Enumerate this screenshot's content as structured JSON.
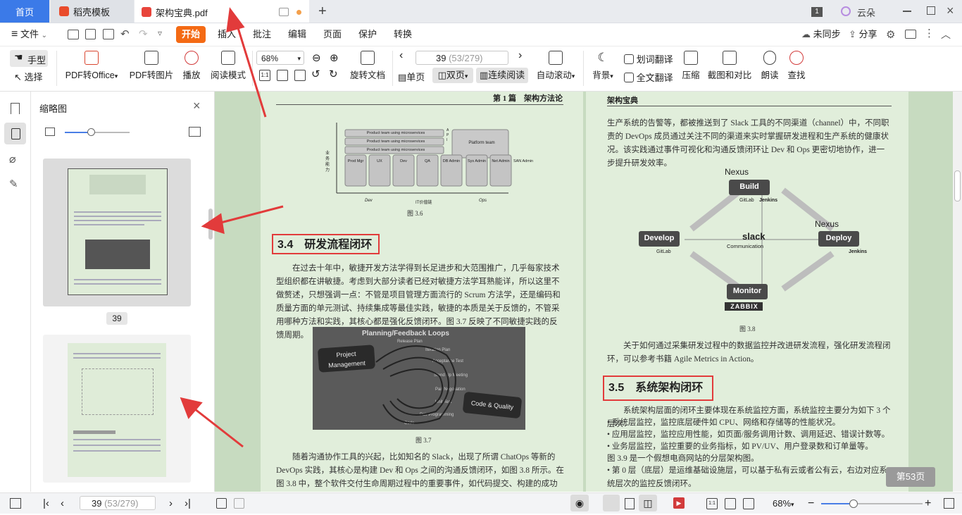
{
  "tabs": {
    "home": "首页",
    "daoke": "稻壳模板",
    "pdf": "架构宝典.pdf",
    "add": "+",
    "page_count_badge": "1",
    "cloud": "云朵"
  },
  "menu": {
    "file": "文件",
    "start": "开始",
    "insert": "插入",
    "annotate": "批注",
    "edit": "编辑",
    "page": "页面",
    "protect": "保护",
    "convert": "转换",
    "sync": "未同步",
    "share": "分享"
  },
  "toolbar": {
    "hand": "手型",
    "select": "选择",
    "pdf_office": "PDF转Office",
    "pdf_image": "PDF转图片",
    "play": "播放",
    "read_mode": "阅读模式",
    "zoom": "68%",
    "rotate": "旋转文档",
    "page_input": "39",
    "page_total": "(53/279)",
    "single": "单页",
    "double": "双页",
    "continuous": "连续阅读",
    "autoscroll": "自动滚动",
    "background": "背景",
    "word_translate": "划词翻译",
    "full_translate": "全文翻译",
    "compress": "压缩",
    "screenshot": "截图和对比",
    "read_aloud": "朗读",
    "search": "查找"
  },
  "thumbnail_panel": {
    "title": "缩略图",
    "page1_number": "39"
  },
  "doc": {
    "left_header": "第 1 篇　架构方法论",
    "right_header": "架构宝典",
    "fig36_caption": "图 3.6",
    "fig36_yaxis": "业务能力",
    "fig36_x": [
      "Dev",
      "IT价值链",
      "Ops"
    ],
    "fig36_rows": [
      "Product team using microservices",
      "Product team using microservices",
      "Product team using microservices"
    ],
    "fig36_platform": "Platform team",
    "fig36_roles": [
      "Prod Mgr",
      "UX",
      "Dev",
      "QA",
      "DB Admin",
      "Sys Admin",
      "Net Admin",
      "SAN Admin"
    ],
    "fig36_api": "A P I",
    "sec34": "3.4　研发流程闭环",
    "para34": "在过去十年中，敏捷开发方法学得到长足进步和大范围推广，几乎每家技术型组织都在讲敏捷。考虑到大部分读者已经对敏捷方法学耳熟能详，所以这里不做赘述，只想强调一点：不管是项目管理方面流行的 Scrum 方法学，还是编码和质量方面的单元测试、持续集成等最佳实践，敏捷的本质是关于反馈的，不管采用哪种方法和实践，其核心都是强化反馈闭环。图 3.7 反映了不同敏捷实践的反馈周期。",
    "fig37_title": "Planning/Feedback Loops",
    "fig37_pm": "Project Management",
    "fig37_cq": "Code & Quality",
    "fig37_items": [
      "Release Plan",
      "Iteration Plan",
      "Acceptance Test",
      "Stand Up Meeting",
      "Pair Negotiation",
      "Unit Test",
      "Pair Programming",
      "Code"
    ],
    "fig37_caption": "图 3.7",
    "para_bottom": "随着沟通协作工具的兴起，比如知名的 Slack，出现了所谓 ChatOps 等新的 DevOps 实践，其核心是构建 Dev 和 Ops 之间的沟通反馈闭环，如图 3.8 所示。在图 3.8 中，整个软件交付生命周期过程中的重要事件，如代码提交、构建的成功和失败、构建包的上传/部署、",
    "right_para1": "生产系统的告警等，都被推送到了 Slack 工具的不同渠道（channel）中，不同职责的 DevOps 成员通过关注不同的渠道来实时掌握研发进程和生产系统的健康状况。该实践通过事件可视化和沟通反馈闭环让 Dev 和 Ops 更密切地协作，进一步提升研发效率。",
    "fig38_nodes": [
      "Build",
      "Deploy",
      "Develop",
      "Monitor"
    ],
    "fig38_nexus": "Nexus",
    "fig38_jenkins": "Jenkins",
    "fig38_gitlab": "GitLab",
    "fig38_slack": "slack",
    "fig38_comm": "Communication",
    "fig38_zabbix": "ZABBIX",
    "fig38_caption": "图 3.8",
    "right_para2": "关于如何通过采集研发过程中的数据监控并改进研发流程，强化研发流程闭环，可以参考书籍 Agile Metrics in Action。",
    "sec35": "3.5　系统架构闭环",
    "para35": "系统架构层面的闭环主要体现在系统监控方面，系统监控主要分为如下 3 个层次：",
    "bullets": [
      "系统层监控，监控底层硬件如 CPU、网络和存储等的性能状况。",
      "应用层监控，监控应用性能，如页面/服务调用计数、调用延迟、错误计数等。",
      "业务层监控，监控重要的业务指标，如 PV/UV、用户登录数和订单量等。"
    ],
    "fig39_line": "图 3.9 是一个假想电商网站的分层架构图。",
    "layer0": "第 0 层（底层）是运维基础设施层，可以基于私有云或者公有云，右边对应系统层次的监控反馈闭环。",
    "page_badge": "第53页"
  },
  "status": {
    "page_input": "39",
    "page_total": "(53/279)",
    "zoom": "68%"
  },
  "colors": {
    "accent_orange": "#f46a14",
    "tab_blue": "#3b7ae8",
    "page_green": "#e1eedb",
    "annotation_red": "#e23b3b"
  }
}
